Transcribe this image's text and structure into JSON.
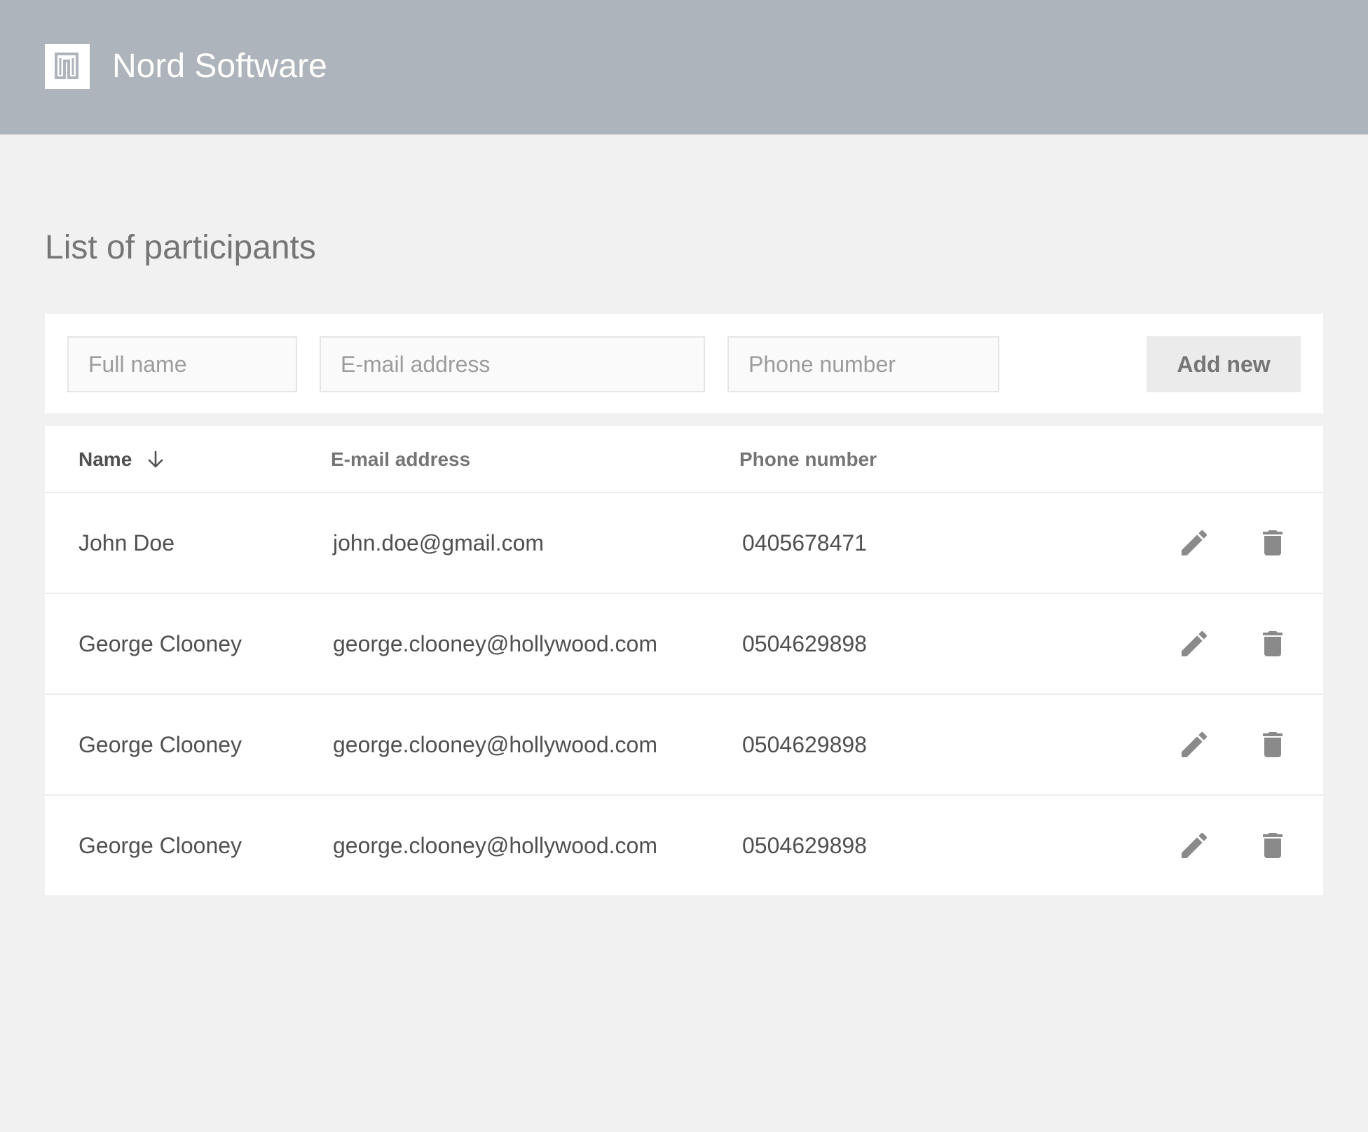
{
  "header": {
    "brand": "Nord Software",
    "logo_icon": "nord-logo-icon"
  },
  "page": {
    "title": "List of participants"
  },
  "form": {
    "name_placeholder": "Full name",
    "email_placeholder": "E-mail address",
    "phone_placeholder": "Phone number",
    "name_value": "",
    "email_value": "",
    "phone_value": "",
    "add_label": "Add new"
  },
  "table": {
    "columns": {
      "name": "Name",
      "email": "E-mail address",
      "phone": "Phone number"
    },
    "sort": {
      "column": "name",
      "icon": "arrow-down-icon"
    },
    "rows": [
      {
        "name": "John Doe",
        "email": "john.doe@gmail.com",
        "phone": "0405678471"
      },
      {
        "name": "George Clooney",
        "email": "george.clooney@hollywood.com",
        "phone": "0504629898"
      },
      {
        "name": "George Clooney",
        "email": "george.clooney@hollywood.com",
        "phone": "0504629898"
      },
      {
        "name": "George Clooney",
        "email": "george.clooney@hollywood.com",
        "phone": "0504629898"
      }
    ],
    "row_actions": {
      "edit_icon": "pencil-icon",
      "delete_icon": "trash-icon"
    }
  },
  "colors": {
    "header_bg": "#adb4bb",
    "page_bg": "#f1f1f1",
    "panel_bg": "#ffffff",
    "icon_gray": "#8a8a8a"
  }
}
